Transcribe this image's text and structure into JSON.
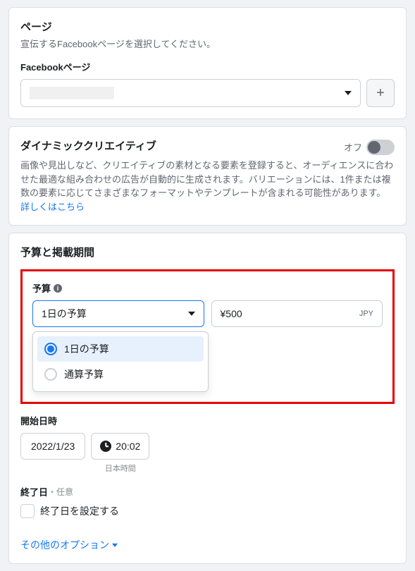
{
  "pageSection": {
    "title": "ページ",
    "description": "宣伝するFacebookページを選択してください。",
    "fieldLabel": "Facebookページ"
  },
  "dynamicCreative": {
    "title": "ダイナミッククリエイティブ",
    "toggleLabel": "オフ",
    "toggleState": "off",
    "description": "画像や見出しなど、クリエイティブの素材となる要素を登録すると、オーディエンスに合わせた最適な組み合わせの広告が自動的に生成されます。バリエーションには、1件または複数の要素に応じてさまざまなフォーマットやテンプレートが含まれる可能性があります。",
    "learnMore": "詳しくはこちら"
  },
  "budget": {
    "sectionTitle": "予算と掲載期間",
    "label": "予算",
    "selectedType": "1日の予算",
    "amount": "¥500",
    "currency": "JPY",
    "options": [
      {
        "label": "1日の予算",
        "selected": true
      },
      {
        "label": "通算予算",
        "selected": false
      }
    ]
  },
  "schedule": {
    "startLabel": "開始日時",
    "date": "2022/1/23",
    "time": "20:02",
    "timezone": "日本時間",
    "endLabel": "終了日",
    "endOptional": "・任意",
    "setEndLabel": "終了日を設定する"
  },
  "otherOptions": "その他のオプション"
}
